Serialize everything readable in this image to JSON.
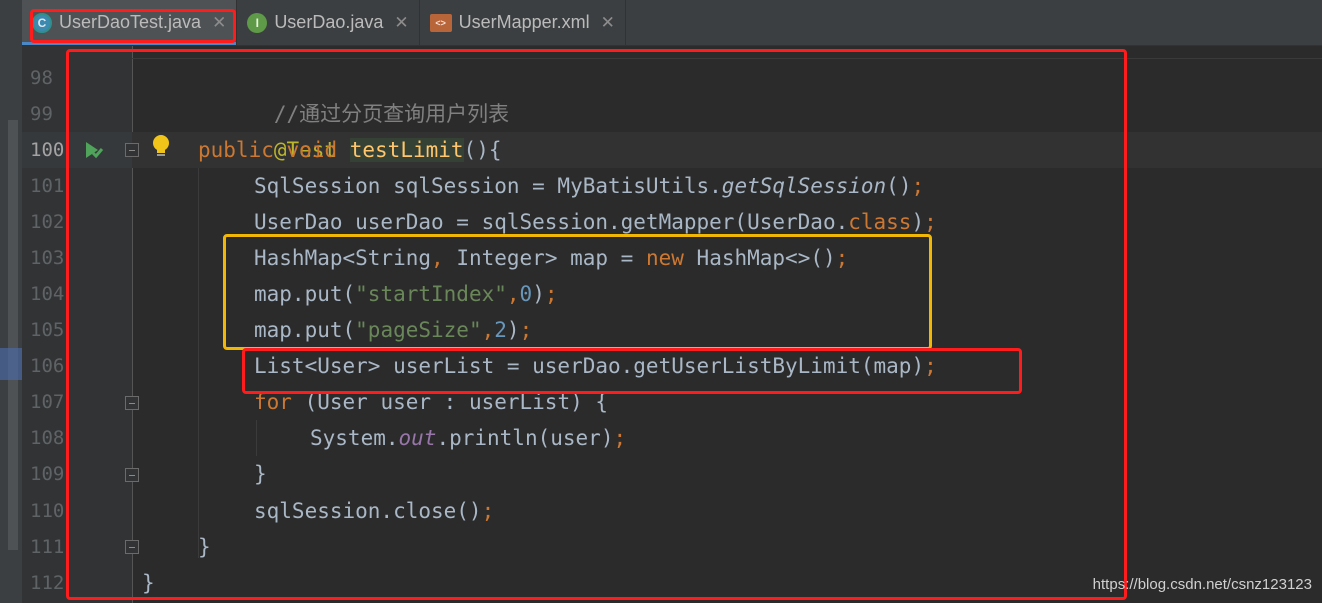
{
  "tabs": [
    {
      "label": "UserDaoTest.java",
      "icon": "class-icon",
      "icon_glyph": "C",
      "active": true
    },
    {
      "label": "UserDao.java",
      "icon": "interface-icon",
      "icon_glyph": "I",
      "active": false
    },
    {
      "label": "UserMapper.xml",
      "icon": "xml-icon",
      "icon_glyph": "<>",
      "active": false
    }
  ],
  "close_glyph": "✕",
  "line_numbers": [
    "98",
    "99",
    "100",
    "101",
    "102",
    "103",
    "104",
    "105",
    "106",
    "107",
    "108",
    "109",
    "110",
    "111",
    "112"
  ],
  "code": {
    "l98": {
      "comment": "//通过分页查询用户列表"
    },
    "l99": {
      "annotation": "@Test"
    },
    "l100": {
      "kw1": "public",
      "kw2": "void",
      "method": "testLimit",
      "rest": "(){"
    },
    "l101": {
      "a": "SqlSession sqlSession = MyBatisUtils.",
      "call": "getSqlSession",
      "b": "()",
      "semi": ";"
    },
    "l102": {
      "a": "UserDao userDao = sqlSession.getMapper(UserDao.",
      "kw": "class",
      "b": ")",
      "semi": ";"
    },
    "l103": {
      "a": "HashMap<String",
      "comma": ",",
      "b": " Integer> map = ",
      "kw": "new",
      "c": " HashMap<>()",
      "semi": ";"
    },
    "l104": {
      "a": "map.put(",
      "str": "\"startIndex\"",
      "comma": ",",
      "num": "0",
      "b": ")",
      "semi": ";"
    },
    "l105": {
      "a": "map.put(",
      "str": "\"pageSize\"",
      "comma": ",",
      "num": "2",
      "b": ")",
      "semi": ";"
    },
    "l106": {
      "a": "List<User> userList = userDao.getUserListByLimit(map)",
      "semi": ";"
    },
    "l107": {
      "kw": "for",
      "a": " (User user : userList) {"
    },
    "l108": {
      "a": "System.",
      "field": "out",
      "b": ".println(user)",
      "semi": ";"
    },
    "l109": {
      "a": "}"
    },
    "l110": {
      "a": "sqlSession.close()",
      "semi": ";"
    },
    "l111": {
      "a": "}"
    },
    "l112": {
      "a": "}"
    }
  },
  "watermark": "https://blog.csdn.net/csnz123123",
  "colors": {
    "annotation_red": "#ff1c1c",
    "annotation_yellow": "#f2b705",
    "editor_bg": "#2b2b2b",
    "keyword": "#cc7832",
    "string": "#6a8759",
    "number": "#6897bb"
  }
}
